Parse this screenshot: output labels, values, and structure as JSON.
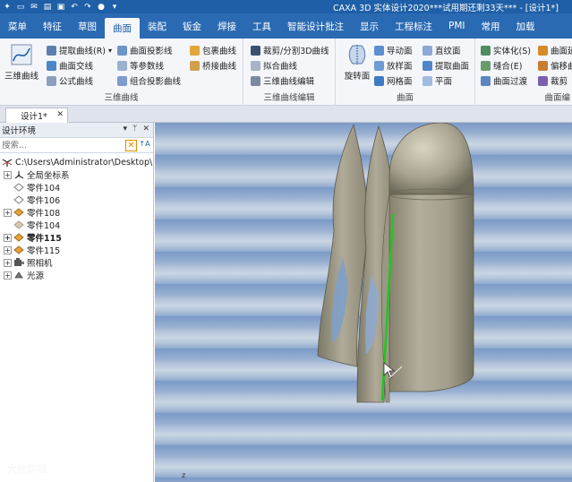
{
  "titlebar": {
    "title": "CAXA 3D 实体设计2020***试用期还剩33天*** - [设计1*]",
    "quick_icons": [
      "app-logo-icon",
      "new-icon",
      "mail-icon",
      "open-icon",
      "save-icon",
      "undo-icon",
      "redo-icon",
      "sphere-icon",
      "more-icon"
    ]
  },
  "menu": {
    "tabs": [
      "菜单",
      "特征",
      "草图",
      "曲面",
      "装配",
      "钣金",
      "焊接",
      "工具",
      "智能设计批注",
      "显示",
      "工程标注",
      "PMI",
      "常用",
      "加载"
    ],
    "active": "曲面"
  },
  "ribbon": {
    "curve3d": {
      "label": "三维曲线",
      "big_button": "三维曲线",
      "items": [
        "提取曲线(R)",
        "曲面交线",
        "公式曲线",
        "曲面投影线",
        "等参数线",
        "组合投影曲线",
        "包裹曲线",
        "桥接曲线"
      ]
    },
    "curve_edit": {
      "label": "三维曲线编辑",
      "items": [
        "裁剪/分割3D曲线",
        "拟合曲线",
        "三维曲线编辑"
      ]
    },
    "surface": {
      "label": "曲面",
      "big_button": "旋转面",
      "items": [
        "导动面",
        "放样面",
        "网格面",
        "直纹面",
        "提取曲面",
        "平面"
      ]
    },
    "surface_edit": {
      "label": "曲面编",
      "items": [
        "实体化(S)",
        "缝合(E)",
        "曲面过渡",
        "曲面延",
        "偏移曲",
        "裁剪"
      ]
    }
  },
  "document": {
    "tab_label": "设计1*"
  },
  "panel": {
    "title": "设计环境",
    "controls": [
      "▾",
      "ᛘ",
      "✕"
    ],
    "search_placeholder": "搜索...",
    "tree": {
      "root": "C:\\Users\\Administrator\\Desktop\\",
      "items": [
        {
          "label": "全局坐标系",
          "icon": "coordinate-system-icon",
          "expandable": true,
          "bold": false
        },
        {
          "label": "零件104",
          "icon": "part-outline-icon",
          "expandable": false,
          "bold": false
        },
        {
          "label": "零件106",
          "icon": "part-outline-icon",
          "expandable": false,
          "bold": false
        },
        {
          "label": "零件108",
          "icon": "part-solid-icon",
          "expandable": true,
          "bold": false
        },
        {
          "label": "零件104",
          "icon": "part-faded-icon",
          "expandable": false,
          "bold": false
        },
        {
          "label": "零件115",
          "icon": "part-solid-icon",
          "expandable": true,
          "bold": true
        },
        {
          "label": "零件115",
          "icon": "part-solid-icon",
          "expandable": true,
          "bold": false
        },
        {
          "label": "照相机",
          "icon": "camera-icon",
          "expandable": true,
          "bold": false
        },
        {
          "label": "光源",
          "icon": "light-icon",
          "expandable": true,
          "bold": false
        }
      ]
    }
  },
  "viewport": {
    "watermark": "大极踪唱",
    "axis_label": "z"
  },
  "colors": {
    "title_bar": "#1f5fa8",
    "menu_bar": "#2a6ab3",
    "model_surface": "#a9a493",
    "highlight_edge": "#1ec81e"
  }
}
